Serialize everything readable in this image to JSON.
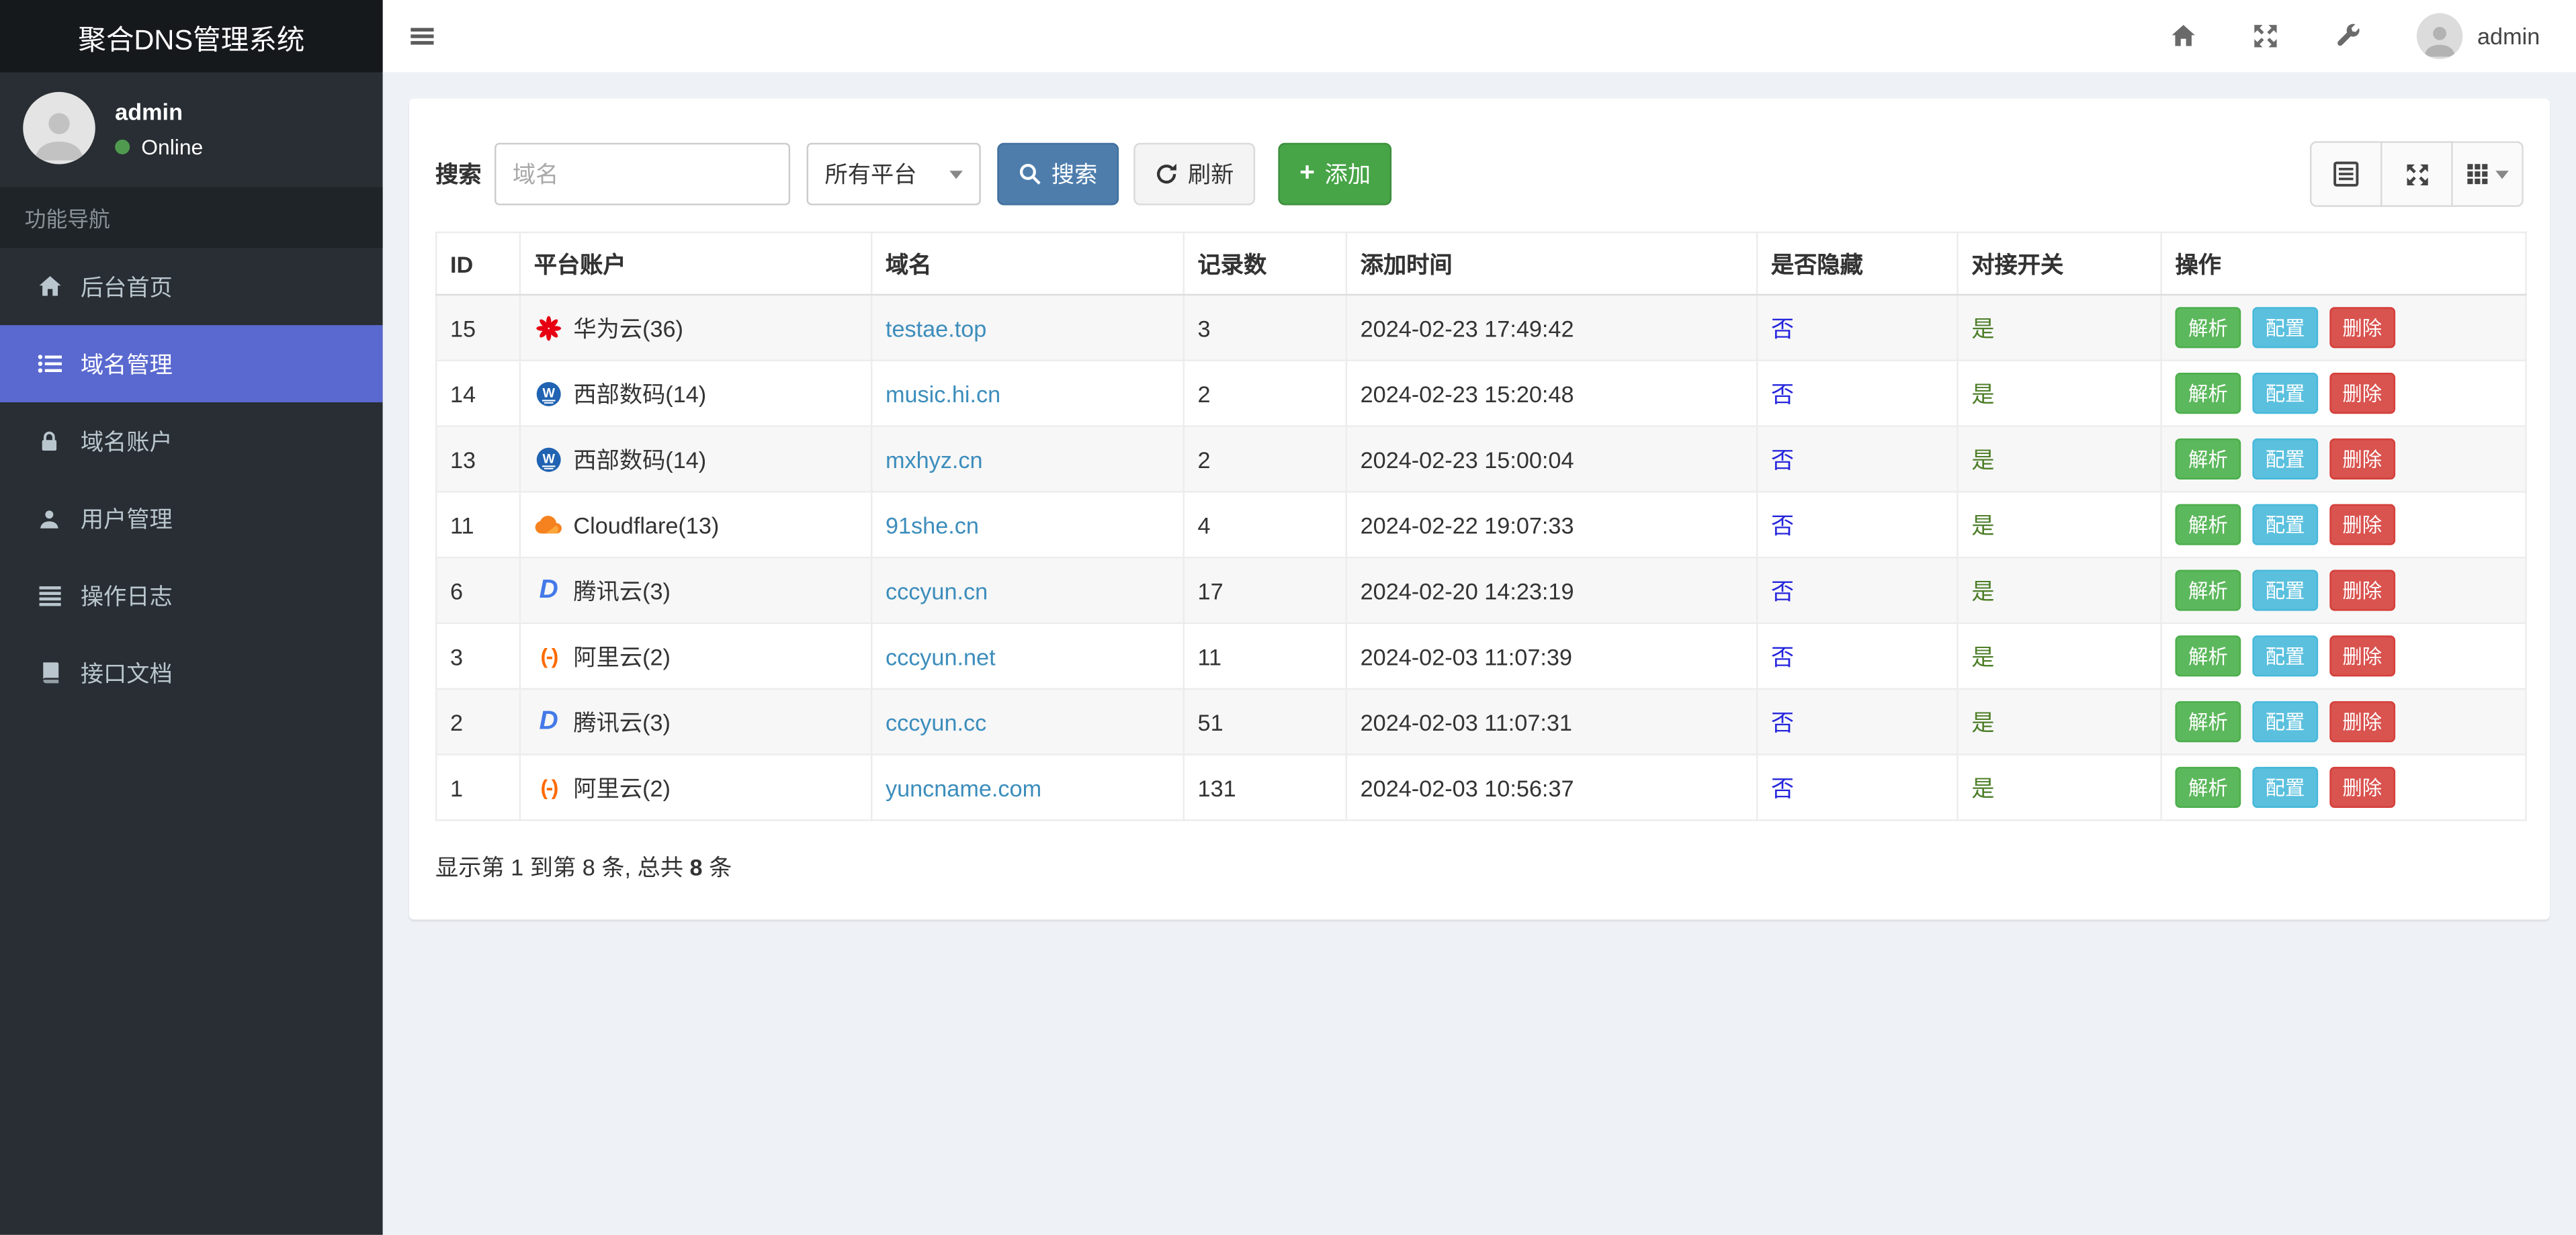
{
  "app": {
    "title": "聚合DNS管理系统"
  },
  "sidebar": {
    "brand": "聚合DNS管理系统",
    "user": {
      "name": "admin",
      "status": "Online"
    },
    "section_label": "功能导航",
    "items": [
      {
        "label": "后台首页",
        "icon": "home-icon",
        "active": false
      },
      {
        "label": "域名管理",
        "icon": "domain-list-icon",
        "active": true
      },
      {
        "label": "域名账户",
        "icon": "lock-icon",
        "active": false
      },
      {
        "label": "用户管理",
        "icon": "user-icon",
        "active": false
      },
      {
        "label": "操作日志",
        "icon": "log-list-icon",
        "active": false
      },
      {
        "label": "接口文档",
        "icon": "book-icon",
        "active": false
      }
    ]
  },
  "topbar": {
    "user_name": "admin",
    "icons": [
      "menu-icon",
      "home-icon",
      "fullscreen-icon",
      "wrench-icon",
      "avatar"
    ]
  },
  "toolbar": {
    "search_label": "搜索",
    "search_placeholder": "域名",
    "search_value": "",
    "platform_select_value": "所有平台",
    "search_button": "搜索",
    "refresh_button": "刷新",
    "add_button": "添加",
    "view_buttons": [
      "list-view-icon",
      "fullscreen-icon",
      "columns-grid-icon"
    ]
  },
  "table": {
    "headers": [
      "ID",
      "平台账户",
      "域名",
      "记录数",
      "添加时间",
      "是否隐藏",
      "对接开关",
      "操作"
    ],
    "action_labels": [
      "解析",
      "配置",
      "删除"
    ],
    "rows": [
      {
        "id": "15",
        "platform_icon": "huawei-cloud-icon",
        "platform_name": "华为云(36)",
        "domain": "testae.top",
        "record_count": "3",
        "added_time": "2024-02-23 17:49:42",
        "hidden": "否",
        "switch": "是"
      },
      {
        "id": "14",
        "platform_icon": "west-digital-icon",
        "platform_name": "西部数码(14)",
        "domain": "music.hi.cn",
        "record_count": "2",
        "added_time": "2024-02-23 15:20:48",
        "hidden": "否",
        "switch": "是"
      },
      {
        "id": "13",
        "platform_icon": "west-digital-icon",
        "platform_name": "西部数码(14)",
        "domain": "mxhyz.cn",
        "record_count": "2",
        "added_time": "2024-02-23 15:00:04",
        "hidden": "否",
        "switch": "是"
      },
      {
        "id": "11",
        "platform_icon": "cloudflare-icon",
        "platform_name": "Cloudflare(13)",
        "domain": "91she.cn",
        "record_count": "4",
        "added_time": "2024-02-22 19:07:33",
        "hidden": "否",
        "switch": "是"
      },
      {
        "id": "6",
        "platform_icon": "dnspod-icon",
        "platform_name": "腾讯云(3)",
        "domain": "cccyun.cn",
        "record_count": "17",
        "added_time": "2024-02-20 14:23:19",
        "hidden": "否",
        "switch": "是"
      },
      {
        "id": "3",
        "platform_icon": "aliyun-icon",
        "platform_name": "阿里云(2)",
        "domain": "cccyun.net",
        "record_count": "11",
        "added_time": "2024-02-03 11:07:39",
        "hidden": "否",
        "switch": "是"
      },
      {
        "id": "2",
        "platform_icon": "dnspod-icon",
        "platform_name": "腾讯云(3)",
        "domain": "cccyun.cc",
        "record_count": "51",
        "added_time": "2024-02-03 11:07:31",
        "hidden": "否",
        "switch": "是"
      },
      {
        "id": "1",
        "platform_icon": "aliyun-icon",
        "platform_name": "阿里云(2)",
        "domain": "yuncname.com",
        "record_count": "131",
        "added_time": "2024-02-03 10:56:37",
        "hidden": "否",
        "switch": "是"
      }
    ]
  },
  "footer": {
    "summary_prefix": "显示第 1 到第 8 条, 总共 ",
    "summary_total": "8",
    "summary_suffix": " 条"
  },
  "colors": {
    "active_menu": "#5a69cf",
    "search_button": "#4e7dac",
    "add_button": "#47a447",
    "resolve_button": "#5cb85c",
    "config_button": "#5bc0de",
    "delete_button": "#d9534f",
    "domain_link": "#3c8dbc",
    "hidden_link": "#2525dd",
    "switch_link": "#4d7e28"
  }
}
